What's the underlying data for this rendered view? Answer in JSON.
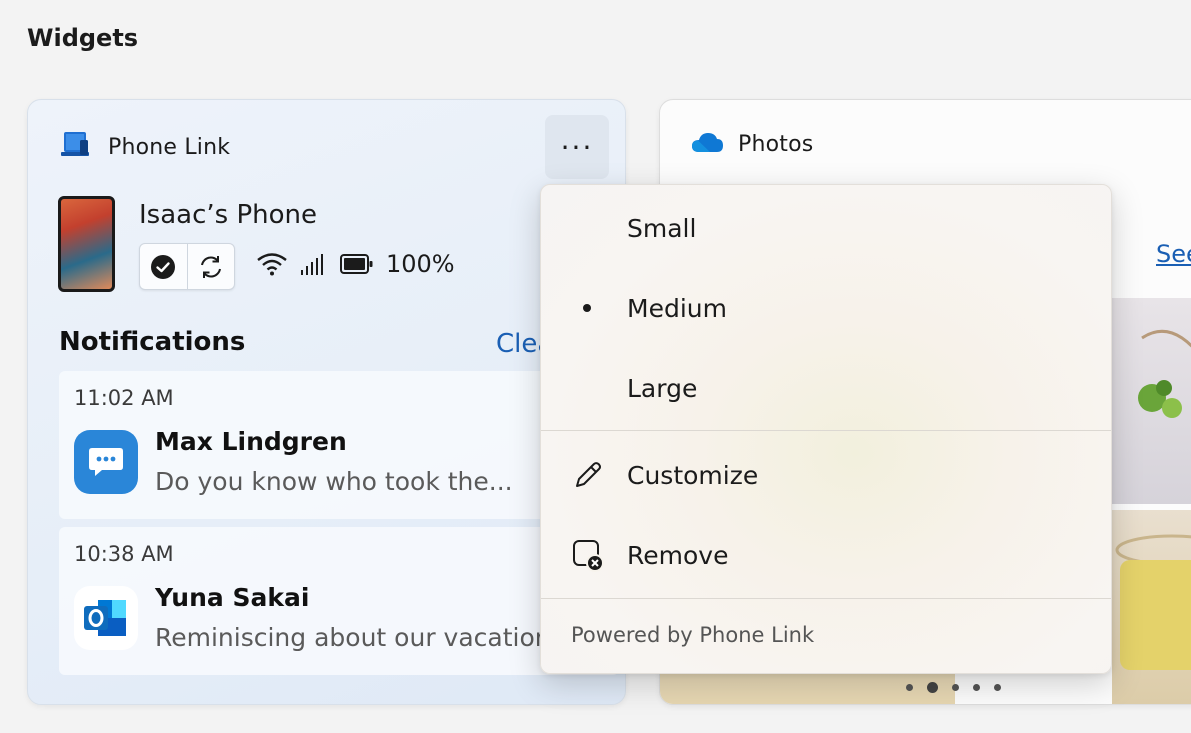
{
  "page": {
    "title": "Widgets"
  },
  "phone_widget": {
    "app_name": "Phone Link",
    "more_label": "···",
    "device_name": "Isaac’s Phone",
    "battery": "100%",
    "notifications_title": "Notifications",
    "clear_label": "Clea",
    "notifications": [
      {
        "time": "11:02 AM",
        "sender": "Max Lindgren",
        "preview": "Do you know who took the...",
        "app_icon": "messages-icon"
      },
      {
        "time": "10:38 AM",
        "sender": "Yuna Sakai",
        "preview": "Reminiscing about our vacation",
        "app_icon": "outlook-icon"
      }
    ]
  },
  "photos_widget": {
    "app_name": "Photos",
    "see_label": "See",
    "pages": 5,
    "active_page": 2
  },
  "menu": {
    "sizes": [
      {
        "label": "Small",
        "selected": false
      },
      {
        "label": "Medium",
        "selected": true
      },
      {
        "label": "Large",
        "selected": false
      }
    ],
    "actions": [
      {
        "label": "Customize",
        "icon": "pencil-icon"
      },
      {
        "label": "Remove",
        "icon": "remove-widget-icon"
      }
    ],
    "footer": "Powered by Phone Link"
  },
  "colors": {
    "accent": "#1a5fb4",
    "messages_icon": "#2a86d8",
    "outlook_icon": "#0f6cbd"
  }
}
